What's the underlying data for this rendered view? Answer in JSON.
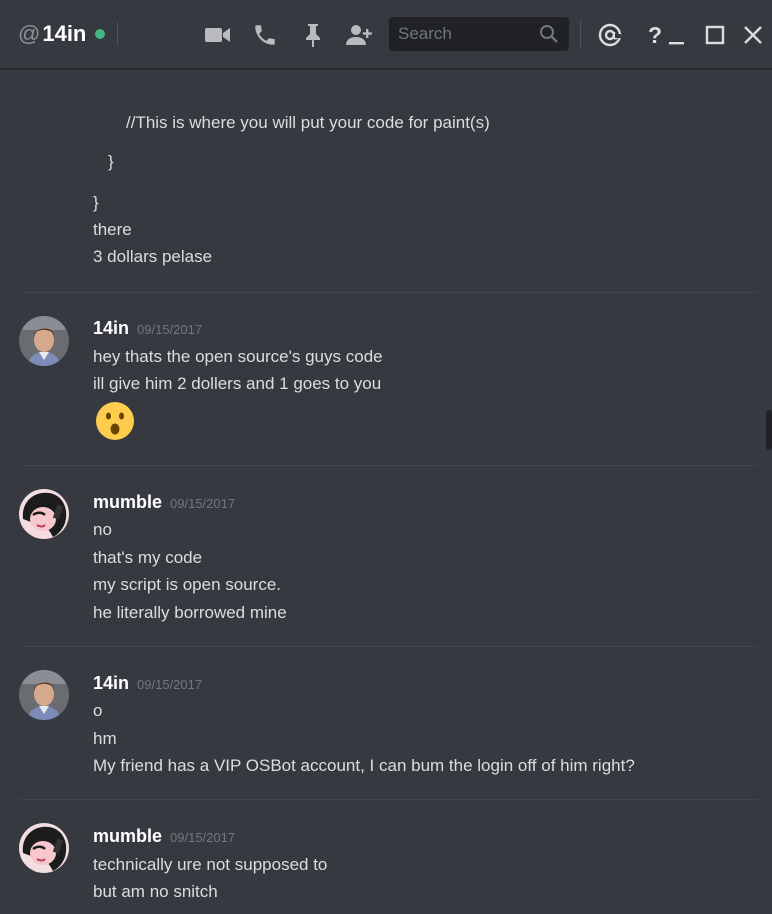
{
  "header": {
    "at_symbol": "@",
    "channel_name": "14in",
    "search_placeholder": "Search"
  },
  "icons": {
    "video": "video-camera-icon",
    "call": "phone-icon",
    "pin": "pin-icon",
    "add_friend": "add-user-icon",
    "search": "search-icon",
    "mentions": "at-icon",
    "help": "help-icon",
    "minimize": "minimize-icon",
    "maximize": "maximize-icon",
    "close": "close-icon"
  },
  "help_symbol": "?",
  "colors": {
    "background": "#36393f",
    "online": "#43b581",
    "timestamp": "#72767d",
    "emoji_yellow": "#ffcc4d"
  },
  "previous_message": {
    "code_lines": [
      "//This is where you will put your code for paint(s)",
      "}",
      "}"
    ],
    "lines": [
      "there",
      "3 dollars pelase"
    ]
  },
  "messages": [
    {
      "author": "14in",
      "timestamp": "09/15/2017",
      "lines": [
        "hey thats the open source's guys code",
        "ill give him 2 dollers and 1 goes to you"
      ],
      "emoji": "hushed-face"
    },
    {
      "author": "mumble",
      "timestamp": "09/15/2017",
      "lines": [
        "no",
        "that's my code",
        "my script is open source.",
        "he literally borrowed mine"
      ]
    },
    {
      "author": "14in",
      "timestamp": "09/15/2017",
      "lines": [
        "o",
        "hm",
        "My friend has a VIP OSBot account, I can bum the login off of him right?"
      ]
    },
    {
      "author": "mumble",
      "timestamp": "09/15/2017",
      "lines": [
        "technically ure not supposed to",
        "but am no snitch"
      ]
    }
  ]
}
